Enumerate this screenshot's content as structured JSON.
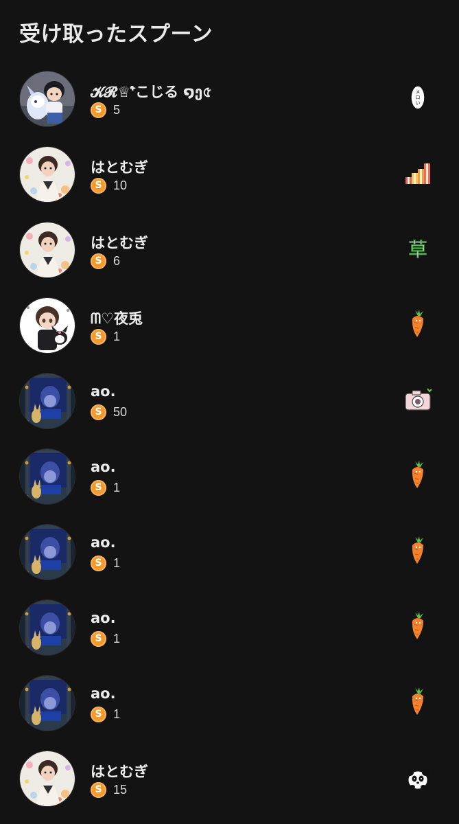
{
  "header": {
    "title": "受け取ったスプーン"
  },
  "gifts": [
    {
      "name": "𝓚𝓡♕⁺͛こじる ໑ე৫",
      "amount": "5",
      "sticker": "melon-sticker",
      "avatar": "chibi-boy-dragon"
    },
    {
      "name": "はとむぎ",
      "amount": "10",
      "sticker": "gift-boxes-sticker",
      "avatar": "boy-flower-cloth"
    },
    {
      "name": "はとむぎ",
      "amount": "6",
      "sticker": "grass-kanji-sticker",
      "avatar": "boy-flower-cloth"
    },
    {
      "name": "ᗰ♡夜兎",
      "amount": "1",
      "sticker": "carrot-sticker",
      "avatar": "chibi-boy-kuromi"
    },
    {
      "name": "ao.",
      "amount": "50",
      "sticker": "camera-sticker",
      "avatar": "blue-window-boy"
    },
    {
      "name": "ao.",
      "amount": "1",
      "sticker": "carrot-sticker",
      "avatar": "blue-window-boy"
    },
    {
      "name": "ao.",
      "amount": "1",
      "sticker": "carrot-sticker",
      "avatar": "blue-window-boy"
    },
    {
      "name": "ao.",
      "amount": "1",
      "sticker": "carrot-sticker",
      "avatar": "blue-window-boy"
    },
    {
      "name": "ao.",
      "amount": "1",
      "sticker": "carrot-sticker",
      "avatar": "blue-window-boy"
    },
    {
      "name": "はとむぎ",
      "amount": "15",
      "sticker": "panda-sticker",
      "avatar": "boy-flower-cloth"
    }
  ],
  "coin_label": "S",
  "sticker_text": {
    "melon": "メロい",
    "grass": "草"
  },
  "colors": {
    "background": "#131313",
    "coin": "#f29a2e",
    "text": "#ececec"
  }
}
